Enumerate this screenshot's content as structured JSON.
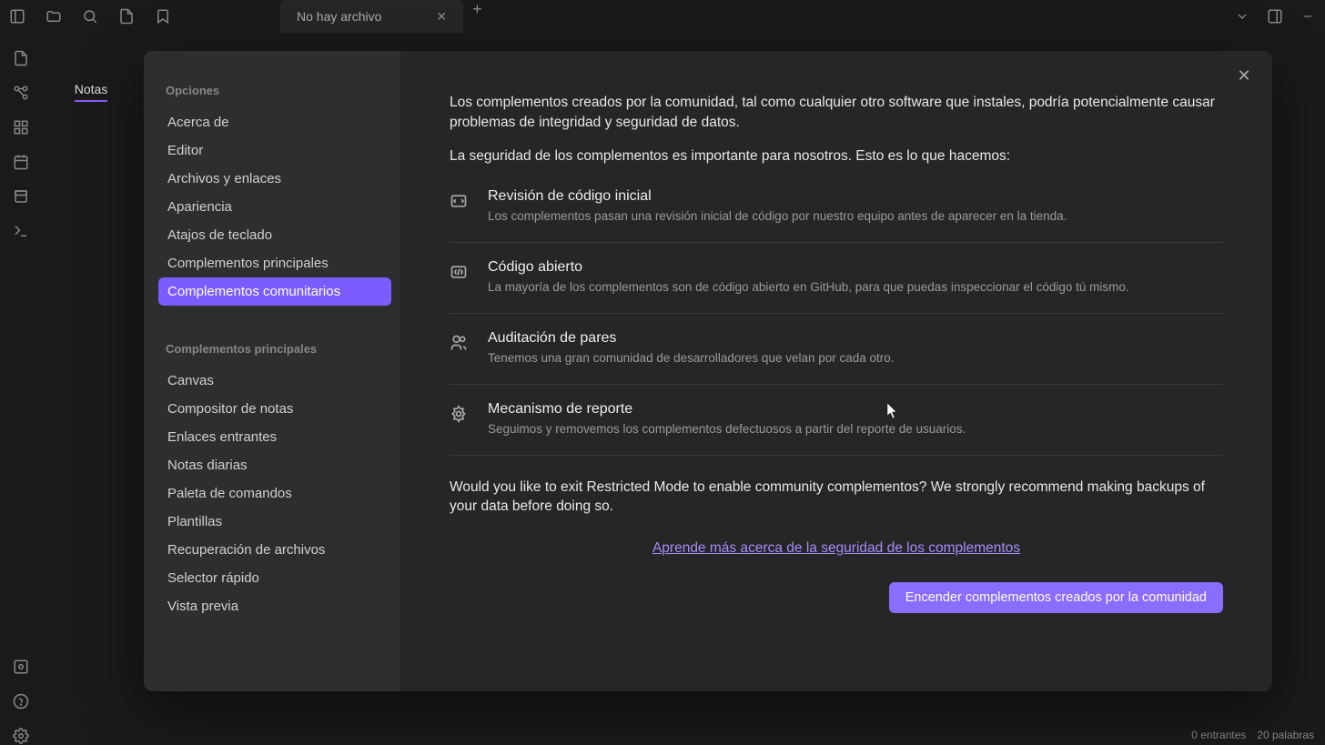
{
  "titlebar": {
    "tab_title": "No hay archivo"
  },
  "left_pane": {
    "tab": "Notas"
  },
  "status": {
    "incoming": "0 entrantes",
    "words": "20 palabras"
  },
  "modal": {
    "section1_header": "Opciones",
    "section2_header": "Complementos principales",
    "nav1": [
      "Acerca de",
      "Editor",
      "Archivos y enlaces",
      "Apariencia",
      "Atajos de teclado",
      "Complementos principales",
      "Complementos comunitarios"
    ],
    "nav1_active_index": 6,
    "nav2": [
      "Canvas",
      "Compositor de notas",
      "Enlaces entrantes",
      "Notas diarias",
      "Paleta de comandos",
      "Plantillas",
      "Recuperación de archivos",
      "Selector rápido",
      "Vista previa"
    ],
    "intro1": "Los complementos creados por la comunidad, tal como cualquier otro software que instales, podría potencialmente causar problemas de integridad y seguridad de datos.",
    "intro2": "La seguridad de los complementos es importante para nosotros. Esto es lo que hacemos:",
    "features": [
      {
        "title": "Revisión de código inicial",
        "desc": "Los complementos pasan una revisión inicial de código por nuestro equipo antes de aparecer en la tienda."
      },
      {
        "title": "Código abierto",
        "desc": "La mayoría de los complementos son de código abierto en GitHub, para que puedas inspeccionar el código tú mismo."
      },
      {
        "title": "Auditación de pares",
        "desc": "Tenemos una gran comunidad de desarrolladores que velan por cada otro."
      },
      {
        "title": "Mecanismo de reporte",
        "desc": "Seguimos y removemos los complementos defectuosos a partir del reporte de usuarios."
      }
    ],
    "prompt": "Would you like to exit Restricted Mode to enable community complementos? We strongly recommend making backups of your data before doing so.",
    "learn_more": "Aprende más acerca de la seguridad de los complementos",
    "button": "Encender complementos creados por la comunidad"
  }
}
